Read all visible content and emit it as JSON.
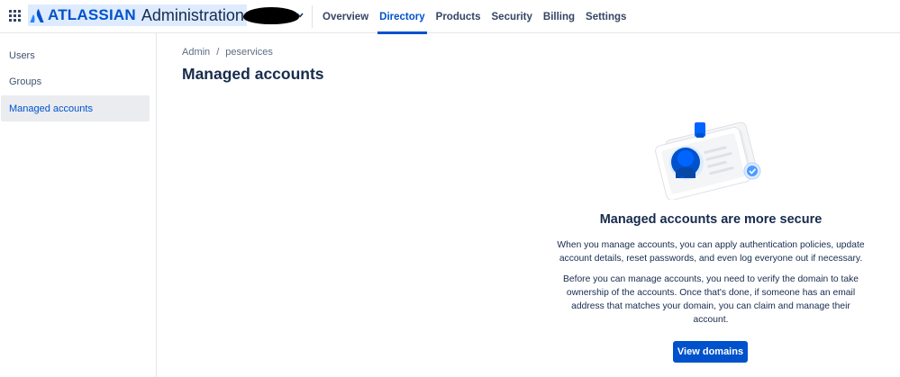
{
  "header": {
    "brand_name": "ATLASSIAN",
    "product": "Administration",
    "nav": [
      {
        "label": "Overview"
      },
      {
        "label": "Directory"
      },
      {
        "label": "Products"
      },
      {
        "label": "Security"
      },
      {
        "label": "Billing"
      },
      {
        "label": "Settings"
      }
    ],
    "active_nav": "Directory",
    "icons": {
      "app_switcher": "grid-icon",
      "logo": "atlassian-logo-icon",
      "org_dropdown": "chevron-down-icon"
    }
  },
  "sidebar": {
    "items": [
      {
        "label": "Users"
      },
      {
        "label": "Groups"
      },
      {
        "label": "Managed accounts"
      }
    ],
    "active": "Managed accounts"
  },
  "breadcrumb": {
    "items": [
      "Admin",
      "peservices"
    ],
    "separator": "/"
  },
  "page": {
    "title": "Managed accounts"
  },
  "empty_state": {
    "title": "Managed accounts are more secure",
    "p1_lines": [
      "When you manage accounts, you can apply authentication policies, update",
      "account details, reset passwords, and even log everyone out if necessary."
    ],
    "p2_lines": [
      "Before you can manage accounts, you need to verify the domain to take",
      "ownership of the accounts. Once that's done, if someone has an email",
      "address that matches your domain, you can claim and manage their",
      "account."
    ],
    "button": "View domains",
    "illustration_icon": "id-card-illustration"
  },
  "colors": {
    "primary": "#0052CC",
    "text": "#172B4D",
    "active_bg": "#EBECF0",
    "brand_bg": "#DEEBFF"
  }
}
